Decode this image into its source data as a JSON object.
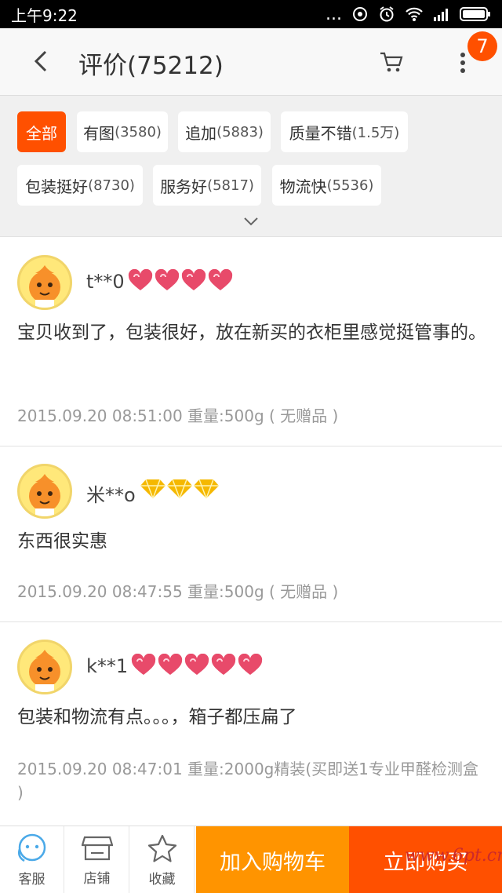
{
  "status_bar": {
    "time": "上午9:22",
    "dots": "..."
  },
  "header": {
    "title": "评价(75212)",
    "badge": "7"
  },
  "filters": [
    {
      "label": "全部",
      "count": "",
      "active": true
    },
    {
      "label": "有图",
      "count": "(3580)"
    },
    {
      "label": "追加",
      "count": "(5883)"
    },
    {
      "label": "质量不错",
      "count": "(1.5万)"
    },
    {
      "label": "包装挺好",
      "count": "(8730)"
    },
    {
      "label": "服务好",
      "count": "(5817)"
    },
    {
      "label": "物流快",
      "count": "(5536)"
    }
  ],
  "reviews": [
    {
      "user": "t**0",
      "rank_icon": "heart",
      "rank_count": 4,
      "text": "宝贝收到了，包装很好，放在新买的衣柜里感觉挺管事的。",
      "meta": "2015.09.20 08:51:00 重量:500g ( 无赠品 )"
    },
    {
      "user": "米**o",
      "rank_icon": "diamond",
      "rank_count": 3,
      "text": "东西很实惠",
      "meta": "2015.09.20 08:47:55 重量:500g ( 无赠品 )"
    },
    {
      "user": "k**1",
      "rank_icon": "heart",
      "rank_count": 5,
      "text": "包装和物流有点。。。，箱子都压扁了",
      "meta": "2015.09.20 08:47:01 重量:2000g精装(买即送1专业甲醛检测盒 )"
    }
  ],
  "bottom_bar": {
    "service": "客服",
    "store": "店铺",
    "favorite": "收藏",
    "add_to_cart": "加入购物车",
    "buy_now": "立即购买"
  },
  "watermark": "www.6pt.cn",
  "colors": {
    "accent": "#ff5000",
    "add_cart": "#ff9400",
    "heart": "#e84a6a",
    "diamond": "#f5b800"
  }
}
